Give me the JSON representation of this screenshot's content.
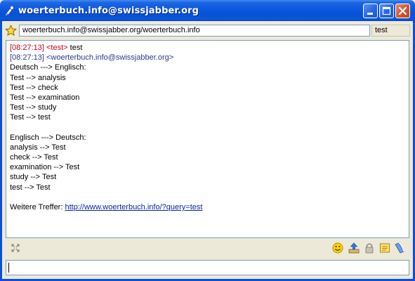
{
  "window": {
    "title": "woerterbuch.info@swissjabber.org"
  },
  "header": {
    "jid_value": "woerterbuch.info@swissjabber.org/woerterbuch.info",
    "nickname": "test"
  },
  "chat": {
    "msg1": {
      "timestamp": "[08:27:13]",
      "sender": "<test>",
      "text": "test"
    },
    "msg2": {
      "timestamp": "[08:27:13]",
      "sender": "<woerterbuch.info@swissjabber.org>"
    },
    "lines": [
      "Deutsch ---> Englisch:",
      "Test --> analysis",
      "Test --> check",
      "Test --> examination",
      "Test --> study",
      "Test --> test",
      "",
      "Englisch ---> Deutsch:",
      "analysis --> Test",
      "check --> Test",
      "examination --> Test",
      "study --> Test",
      "test --> Test",
      ""
    ],
    "more_label": "Weitere Treffer:",
    "more_link": "http://www.woerterbuch.info/?query=test"
  },
  "input": {
    "value": ""
  },
  "icons": {
    "title": "jabber-bulb-icon",
    "favorite": "star-icon",
    "resize": "resize-arrows-icon",
    "emoticon": "smiley-icon",
    "send_file": "send-file-icon",
    "encryption": "lock-icon",
    "log": "notepad-icon",
    "history": "history-icon"
  },
  "colors": {
    "titlebar": "#0a58e0",
    "timestamp_self": "#c8001e",
    "timestamp_other": "#2b3a8c",
    "link": "#0a1ea0"
  }
}
